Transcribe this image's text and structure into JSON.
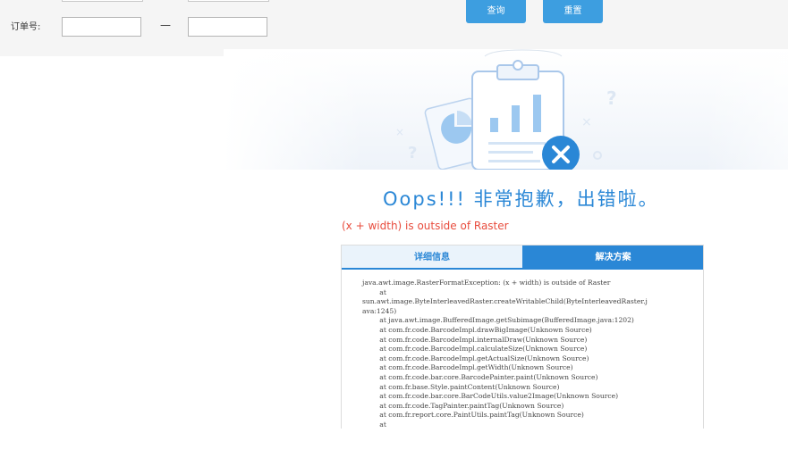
{
  "filter": {
    "order_label": "订单号:",
    "range_separator": "—",
    "order_from": "",
    "order_to": "",
    "query_label": "查询",
    "reset_label": "重置"
  },
  "error": {
    "title": "Oops!!! 非常抱歉，出错啦。",
    "message": "(x + width) is outside of Raster",
    "tabs": [
      {
        "label": "详细信息",
        "active": true
      },
      {
        "label": "解决方案",
        "active": false
      }
    ],
    "trace": [
      "java.awt.image.RasterFormatException: (x + width) is outside of Raster",
      "        at",
      "sun.awt.image.ByteInterleavedRaster.createWritableChild(ByteInterleavedRaster.j",
      "ava:1245)",
      "        at java.awt.image.BufferedImage.getSubimage(BufferedImage.java:1202)",
      "        at com.fr.code.BarcodeImpl.drawBigImage(Unknown Source)",
      "        at com.fr.code.BarcodeImpl.internalDraw(Unknown Source)",
      "        at com.fr.code.BarcodeImpl.calculateSize(Unknown Source)",
      "        at com.fr.code.BarcodeImpl.getActualSize(Unknown Source)",
      "        at com.fr.code.BarcodeImpl.getWidth(Unknown Source)",
      "        at com.fr.code.bar.core.BarcodePainter.paint(Unknown Source)",
      "        at com.fr.base.Style.paintContent(Unknown Source)",
      "        at com.fr.code.bar.core.BarCodeUtils.value2Image(Unknown Source)",
      "        at com.fr.code.TagPainter.paintTag(Unknown Source)",
      "        at com.fr.report.core.PaintUtils.paintTag(Unknown Source)",
      "        at"
    ]
  },
  "colors": {
    "accent": "#2a87d6",
    "button": "#3d9ee0",
    "error_text": "#e84c3d",
    "filter_bg": "#f5f5f5"
  }
}
